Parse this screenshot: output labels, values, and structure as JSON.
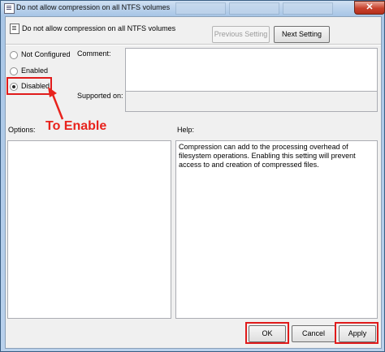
{
  "window": {
    "title": "Do not allow compression on all NTFS volumes",
    "close_glyph": "✕"
  },
  "header": {
    "setting_name": "Do not allow compression on all NTFS volumes",
    "previous_label": "Previous Setting",
    "next_label": "Next Setting"
  },
  "state": {
    "options": [
      {
        "label": "Not Configured",
        "selected": false
      },
      {
        "label": "Enabled",
        "selected": false
      },
      {
        "label": "Disabled",
        "selected": true
      }
    ]
  },
  "labels": {
    "comment": "Comment:",
    "supported_on": "Supported on:",
    "options": "Options:",
    "help": "Help:"
  },
  "comment_value": "",
  "supported_on_value": "",
  "help_text": "Compression can add to the processing overhead of filesystem operations.  Enabling this setting will prevent access to and creation of compressed files.",
  "annotation": {
    "text": "To Enable",
    "color": "#e8231d"
  },
  "footer": {
    "ok_label": "OK",
    "cancel_label": "Cancel",
    "apply_label": "Apply"
  },
  "colors": {
    "highlight": "#e01b1b",
    "window_frame": "#a9c6e6"
  },
  "icons": {
    "title": "policy-document-icon",
    "header": "policy-document-icon"
  }
}
